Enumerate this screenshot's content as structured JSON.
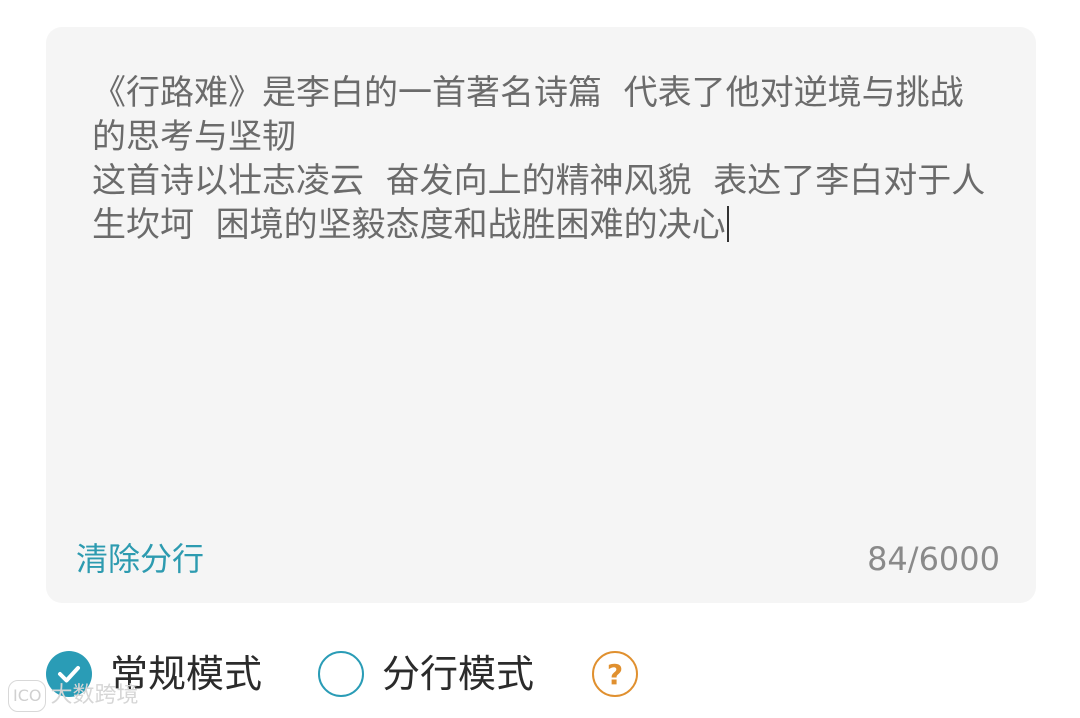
{
  "editor": {
    "text": "《行路难》是李白的一首著名诗篇  代表了他对逆境与挑战的思考与坚韧\n这首诗以壮志凌云  奋发向上的精神风貌  表达了李白对于人生坎坷  困境的坚毅态度和战胜困难的决心",
    "clear_label": "清除分行",
    "char_count": "84/6000"
  },
  "modes": {
    "normal": {
      "label": "常规模式",
      "checked": true,
      "icon": "check-icon"
    },
    "line_break": {
      "label": "分行模式",
      "checked": false
    },
    "help_icon": "question-mark-icon",
    "help_glyph": "?"
  },
  "watermark": {
    "text": "大数跨境"
  },
  "colors": {
    "accent": "#2a9cb6",
    "help": "#e0902f",
    "card_background": "#f5f5f5",
    "text": "#6b6b6b"
  }
}
